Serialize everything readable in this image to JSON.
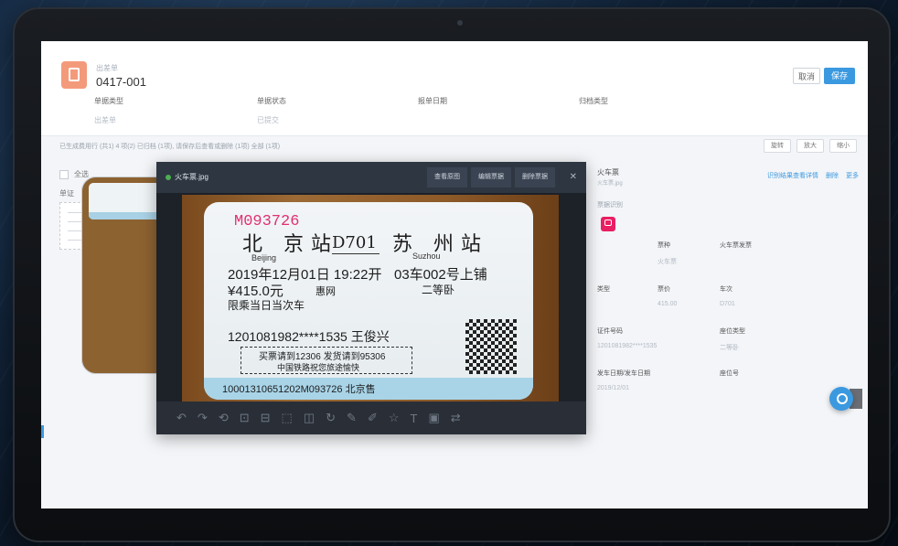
{
  "header": {
    "doc_type": "出差单",
    "doc_number": "0417-001",
    "btn_cancel": "取消",
    "btn_save": "保存",
    "meta": [
      {
        "key": "单据类型",
        "value": "出差单"
      },
      {
        "key": "单据状态",
        "value": "已提交"
      },
      {
        "key": "报单日期",
        "value": ""
      },
      {
        "key": "归档类型",
        "value": ""
      }
    ]
  },
  "tip": "已生成费用行 (共1) 4 项(2) 已归档 (1项), 请保存后查看或删除 (1项) 全部 (1项)",
  "tools": [
    "旋转",
    "放大",
    "缩小"
  ],
  "left": {
    "select_all": "全选",
    "group": "单证"
  },
  "viewer": {
    "filename": "火车票.jpg",
    "buttons": [
      "查看原图",
      "编辑票据",
      "删除票据"
    ],
    "close": "✕",
    "toolbar_icons": [
      "↶",
      "↷",
      "⟲",
      "⊡",
      "⊟",
      "⬚",
      "◫",
      "↻",
      "✎",
      "✐",
      "☆",
      "T",
      "▣",
      "⇄"
    ]
  },
  "ticket": {
    "serial": "M093726",
    "from": "北 京站",
    "from_en": "Beijing",
    "train": "D701",
    "to": "苏 州站",
    "to_en": "Suzhou",
    "datetime": "2019年12月01日 19:22开",
    "seat": "03车002号上铺",
    "price": "¥415.0元",
    "mark": "惠网",
    "class": "二等卧",
    "limit": "限乘当日当次车",
    "id": "1201081982****1535 王俊兴",
    "box_line1": "买票请到12306 发货请到95306",
    "box_line2": "中国铁路祝您旅途愉快",
    "bottom": "10001310651202M093726 北京售"
  },
  "right": {
    "title": "火车票",
    "subtitle": "火车票.jpg",
    "actions": [
      "识别结果查看详情",
      "删除",
      "更多"
    ],
    "section": "票据识别",
    "fields": [
      {
        "key": "票种",
        "value": "火车票"
      },
      {
        "key": "发票类型",
        "value": "火车票发票"
      },
      {
        "key": "类型",
        "value": ""
      },
      {
        "key": "票价",
        "value": "415.00"
      },
      {
        "key": "车次",
        "value": "D701"
      },
      {
        "key": "证件号码",
        "value": "1201081982****1535"
      },
      {
        "key": "座位类型",
        "value": "二等卧"
      },
      {
        "key": "发车日期/发车日期",
        "value": "2019/12/01"
      },
      {
        "key": "座位号",
        "value": ""
      }
    ]
  }
}
